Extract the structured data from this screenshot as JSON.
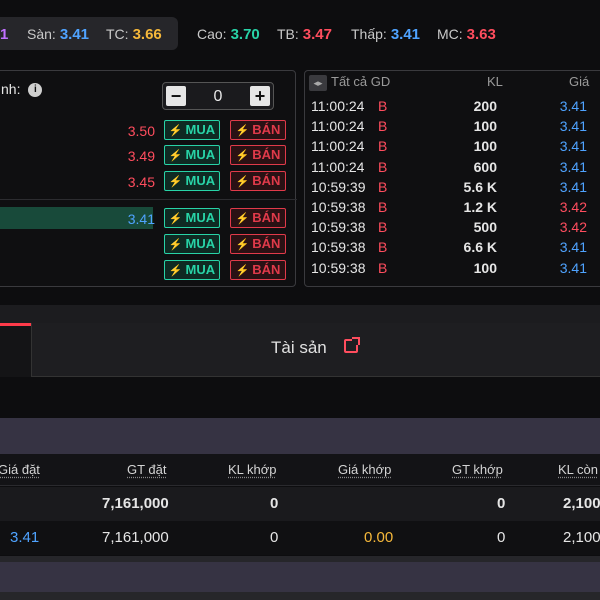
{
  "header": {
    "cut_value": "1",
    "stats": [
      {
        "label": "Sàn:",
        "value": "3.41",
        "color": "#4fa3ff"
      },
      {
        "label": "TC:",
        "value": "3.66",
        "color": "#f6b83a"
      },
      {
        "label": "Cao:",
        "value": "3.70",
        "color": "#28d3a7"
      },
      {
        "label": "TB:",
        "value": "3.47",
        "color": "#ff4d5e"
      },
      {
        "label": "Thấp:",
        "value": "3.41",
        "color": "#4fa3ff"
      },
      {
        "label": "MC:",
        "value": "3.63",
        "color": "#ff4d5e"
      }
    ]
  },
  "order_panel": {
    "quantity_label": "nh:",
    "info_icon": "i",
    "quantity_value": "0",
    "minus": "−",
    "plus": "+",
    "buy_label": "MUA",
    "sell_label": "BÁN",
    "bolt": "⚡",
    "prices": [
      "3.50",
      "3.49",
      "3.45",
      "3.41",
      "",
      ""
    ]
  },
  "trades": {
    "toggle": "◂▸",
    "col_all": "Tất cả GD",
    "col_kl": "KL",
    "col_price": "Giá",
    "rows": [
      {
        "time": "11:00:24",
        "side": "B",
        "kl": "200",
        "price": "3.41",
        "color": "#4fa3ff"
      },
      {
        "time": "11:00:24",
        "side": "B",
        "kl": "100",
        "price": "3.41",
        "color": "#4fa3ff"
      },
      {
        "time": "11:00:24",
        "side": "B",
        "kl": "100",
        "price": "3.41",
        "color": "#4fa3ff"
      },
      {
        "time": "11:00:24",
        "side": "B",
        "kl": "600",
        "price": "3.41",
        "color": "#4fa3ff"
      },
      {
        "time": "10:59:39",
        "side": "B",
        "kl": "5.6 K",
        "price": "3.41",
        "color": "#4fa3ff"
      },
      {
        "time": "10:59:38",
        "side": "B",
        "kl": "1.2 K",
        "price": "3.42",
        "color": "#ff4d5e"
      },
      {
        "time": "10:59:38",
        "side": "B",
        "kl": "500",
        "price": "3.42",
        "color": "#ff4d5e"
      },
      {
        "time": "10:59:38",
        "side": "B",
        "kl": "6.6 K",
        "price": "3.41",
        "color": "#4fa3ff"
      },
      {
        "time": "10:59:38",
        "side": "B",
        "kl": "100",
        "price": "3.41",
        "color": "#4fa3ff"
      }
    ]
  },
  "tabs": {
    "assets_label": "Tài sản"
  },
  "orders_table": {
    "headers": [
      "Giá đặt",
      "GT đặt",
      "KL khớp",
      "Giá khớp",
      "GT khớp",
      "KL còn"
    ],
    "rows": [
      [
        "",
        "7,161,000",
        "0",
        "",
        "0",
        "2,100"
      ],
      [
        "3.41",
        "7,161,000",
        "0",
        "0.00",
        "0",
        "2,100"
      ]
    ]
  }
}
